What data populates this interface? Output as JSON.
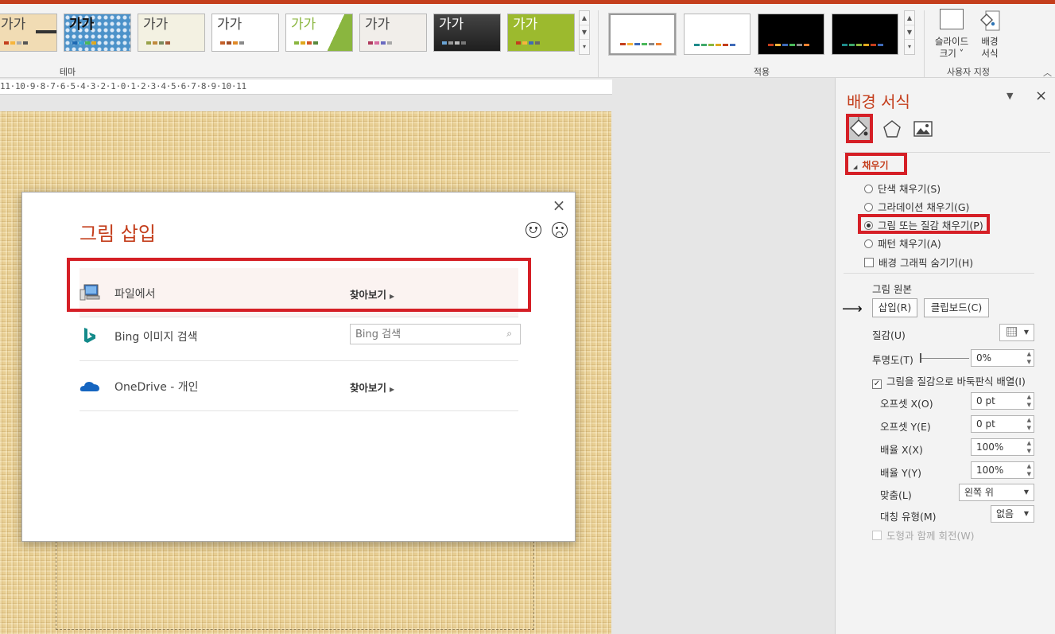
{
  "ribbon": {
    "theme_thumbs": [
      {
        "label": "가가",
        "bg": "#f1dcb4",
        "text": "#333"
      },
      {
        "label": "가가",
        "bg": "#4c92c9",
        "text": "#222"
      },
      {
        "label": "가가",
        "bg": "#f3f1e2",
        "text": "#333"
      },
      {
        "label": "가가",
        "bg": "#ffffff",
        "text": "#333"
      },
      {
        "label": "가가",
        "bg": "#ffffff",
        "text": "#8ab63f"
      },
      {
        "label": "가가",
        "bg": "#f1eeea",
        "text": "#333"
      },
      {
        "label": "가가",
        "bg": "#2a2a2a",
        "text": "#ffffff"
      },
      {
        "label": "가가",
        "bg": "#9cba2e",
        "text": "#ffffff"
      }
    ],
    "theme_group_label": "테마",
    "apply_group_label": "적용",
    "slide_size": {
      "line1": "슬라이드",
      "line2": "크기 ˅"
    },
    "bg_format": {
      "line1": "배경",
      "line2": "서식"
    },
    "custom_group_label": "사용자 지정",
    "collapse_icon": "chevron-up-icon"
  },
  "ruler": {
    "text": "11·10·9·8·7·6·5·4·3·2·1·0·1·2·3·4·5·6·7·8·9·10·11"
  },
  "dialog": {
    "title": "그림 삽입",
    "close": "×",
    "rows": [
      {
        "label": "파일에서",
        "action": "찾아보기",
        "icon": "computer-icon"
      },
      {
        "label": "Bing 이미지 검색",
        "placeholder": "Bing 검색",
        "icon": "bing-icon"
      },
      {
        "label": "OneDrive - 개인",
        "action": "찾아보기",
        "icon": "cloud-icon"
      }
    ]
  },
  "pane": {
    "title": "배경 서식",
    "menu": "▼",
    "close": "×",
    "section": "채우기",
    "options": [
      {
        "label": "단색 채우기(S)",
        "selected": false
      },
      {
        "label": "그라데이션 채우기(G)",
        "selected": false
      },
      {
        "label": "그림 또는 질감 채우기(P)",
        "selected": true
      },
      {
        "label": "패턴 채우기(A)",
        "selected": false
      }
    ],
    "hide_bg_graphics": "배경 그래픽 숨기기(H)",
    "picture_source": "그림 원본",
    "insert_btn": "삽입(R)",
    "clipboard_btn": "클립보드(C)",
    "texture_label": "질감(U)",
    "transparency_label": "투명도(T)",
    "transparency_value": "0%",
    "tile_label": "그림을 질감으로 바둑판식 배열(I)",
    "offset_x_label": "오프셋 X(O)",
    "offset_x_value": "0 pt",
    "offset_y_label": "오프셋 Y(E)",
    "offset_y_value": "0 pt",
    "scale_x_label": "배율 X(X)",
    "scale_x_value": "100%",
    "scale_y_label": "배율 Y(Y)",
    "scale_y_value": "100%",
    "align_label": "맞춤(L)",
    "align_value": "왼쪽 위",
    "mirror_label": "대칭 유형(M)",
    "mirror_value": "없음",
    "rotate_label": "도형과 함께 회전(W)"
  },
  "colors": {
    "accent": "#c43e1c",
    "highlight": "#d51f26"
  }
}
